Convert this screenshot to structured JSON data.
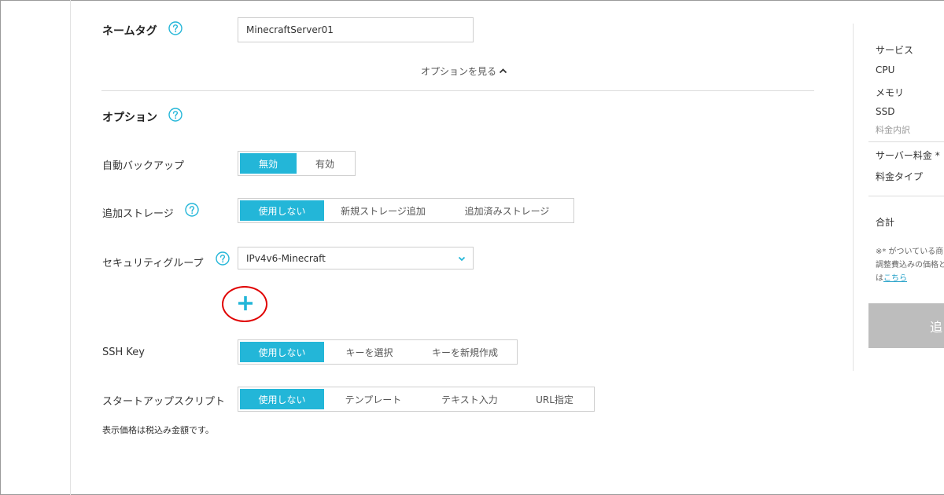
{
  "form": {
    "name_tag": {
      "label": "ネームタグ",
      "value": "MinecraftServer01"
    },
    "options_toggle": "オプションを見る",
    "options_heading": "オプション",
    "auto_backup": {
      "label": "自動バックアップ",
      "options": [
        "無効",
        "有効"
      ],
      "selected": 0
    },
    "extra_storage": {
      "label": "追加ストレージ",
      "options": [
        "使用しない",
        "新規ストレージ追加",
        "追加済みストレージ"
      ],
      "selected": 0
    },
    "security_group": {
      "label": "セキュリティグループ",
      "value": "IPv4v6-Minecraft"
    },
    "ssh_key": {
      "label": "SSH Key",
      "options": [
        "使用しない",
        "キーを選択",
        "キーを新規作成"
      ],
      "selected": 0
    },
    "startup_script": {
      "label": "スタートアップスクリプト",
      "options": [
        "使用しない",
        "テンプレート",
        "テキスト入力",
        "URL指定"
      ],
      "selected": 0
    },
    "tax_note": "表示価格は税込み金額です。"
  },
  "summary": {
    "service": "サービス",
    "cpu": "CPU",
    "memory": "メモリ",
    "ssd": "SSD",
    "breakdown": "料金内訳",
    "server_fee": "サーバー料金 *",
    "fee_type": "料金タイプ",
    "total": "合計",
    "note_line1": "※* がついている商",
    "note_line2": "調整費込みの価格と",
    "note_line3_prefix": "は",
    "note_link": "こちら",
    "submit": "追"
  },
  "colors": {
    "accent": "#23b6d8",
    "annotation_ring": "#e00000",
    "disabled_button": "#bdbdbd"
  },
  "icons": {
    "help": "question-circle-icon",
    "chevron_up": "chevron-up-icon",
    "chevron_down": "chevron-down-icon",
    "add": "plus-icon"
  }
}
